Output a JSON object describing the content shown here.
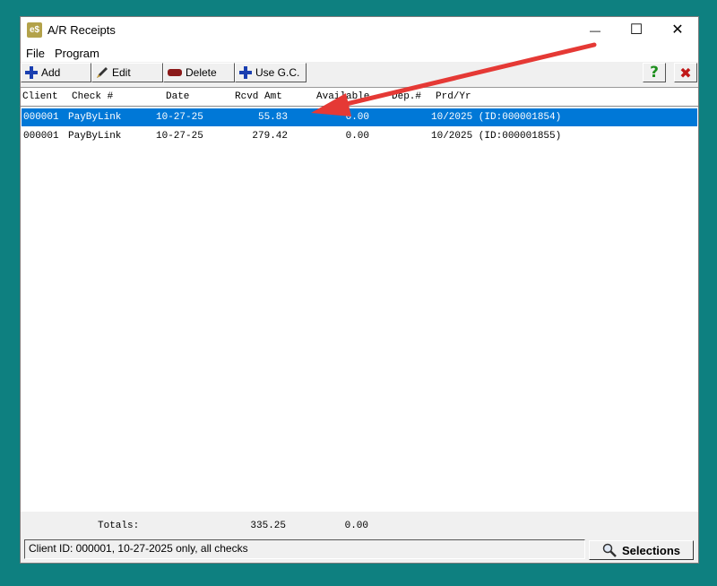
{
  "window": {
    "app_icon_text": "e$",
    "title": "A/R Receipts",
    "minimize_glyph": "—",
    "maximize_glyph": "☐",
    "close_glyph": "✕"
  },
  "menu": {
    "file": "File",
    "program": "Program"
  },
  "toolbar": {
    "add_label": "Add",
    "edit_label": "Edit",
    "delete_label": "Delete",
    "use_gc_label": "Use G.C.",
    "help_glyph": "?",
    "exit_glyph": "✖"
  },
  "columns": {
    "client": "Client",
    "check": "Check #",
    "date": "Date",
    "rcvd_amt": "Rcvd Amt",
    "available": "Available",
    "dep": "Dep.#",
    "prd_yr": "Prd/Yr"
  },
  "rows": [
    {
      "client": "000001",
      "check": "PayByLink",
      "date": "10-27-25",
      "rcvd_amt": "55.83",
      "available": "0.00",
      "dep": "",
      "prd_yr": "10/2025 (ID:000001854)"
    },
    {
      "client": "000001",
      "check": "PayByLink",
      "date": "10-27-25",
      "rcvd_amt": "279.42",
      "available": "0.00",
      "dep": "",
      "prd_yr": "10/2025 (ID:000001855)"
    }
  ],
  "totals": {
    "label": "Totals:",
    "rcvd_amt": "335.25",
    "available": "0.00"
  },
  "status": {
    "text": "Client ID: 000001, 10-27-2025 only, all checks"
  },
  "selections": {
    "label": "Selections"
  },
  "colors": {
    "desktop": "#0e8080",
    "selection": "#0078d7",
    "arrow": "#e53935",
    "add_icon": "#1a3fb0",
    "delete_icon": "#8b1a1a",
    "help_icon": "#1e8f1e",
    "exit_icon": "#c01818"
  }
}
